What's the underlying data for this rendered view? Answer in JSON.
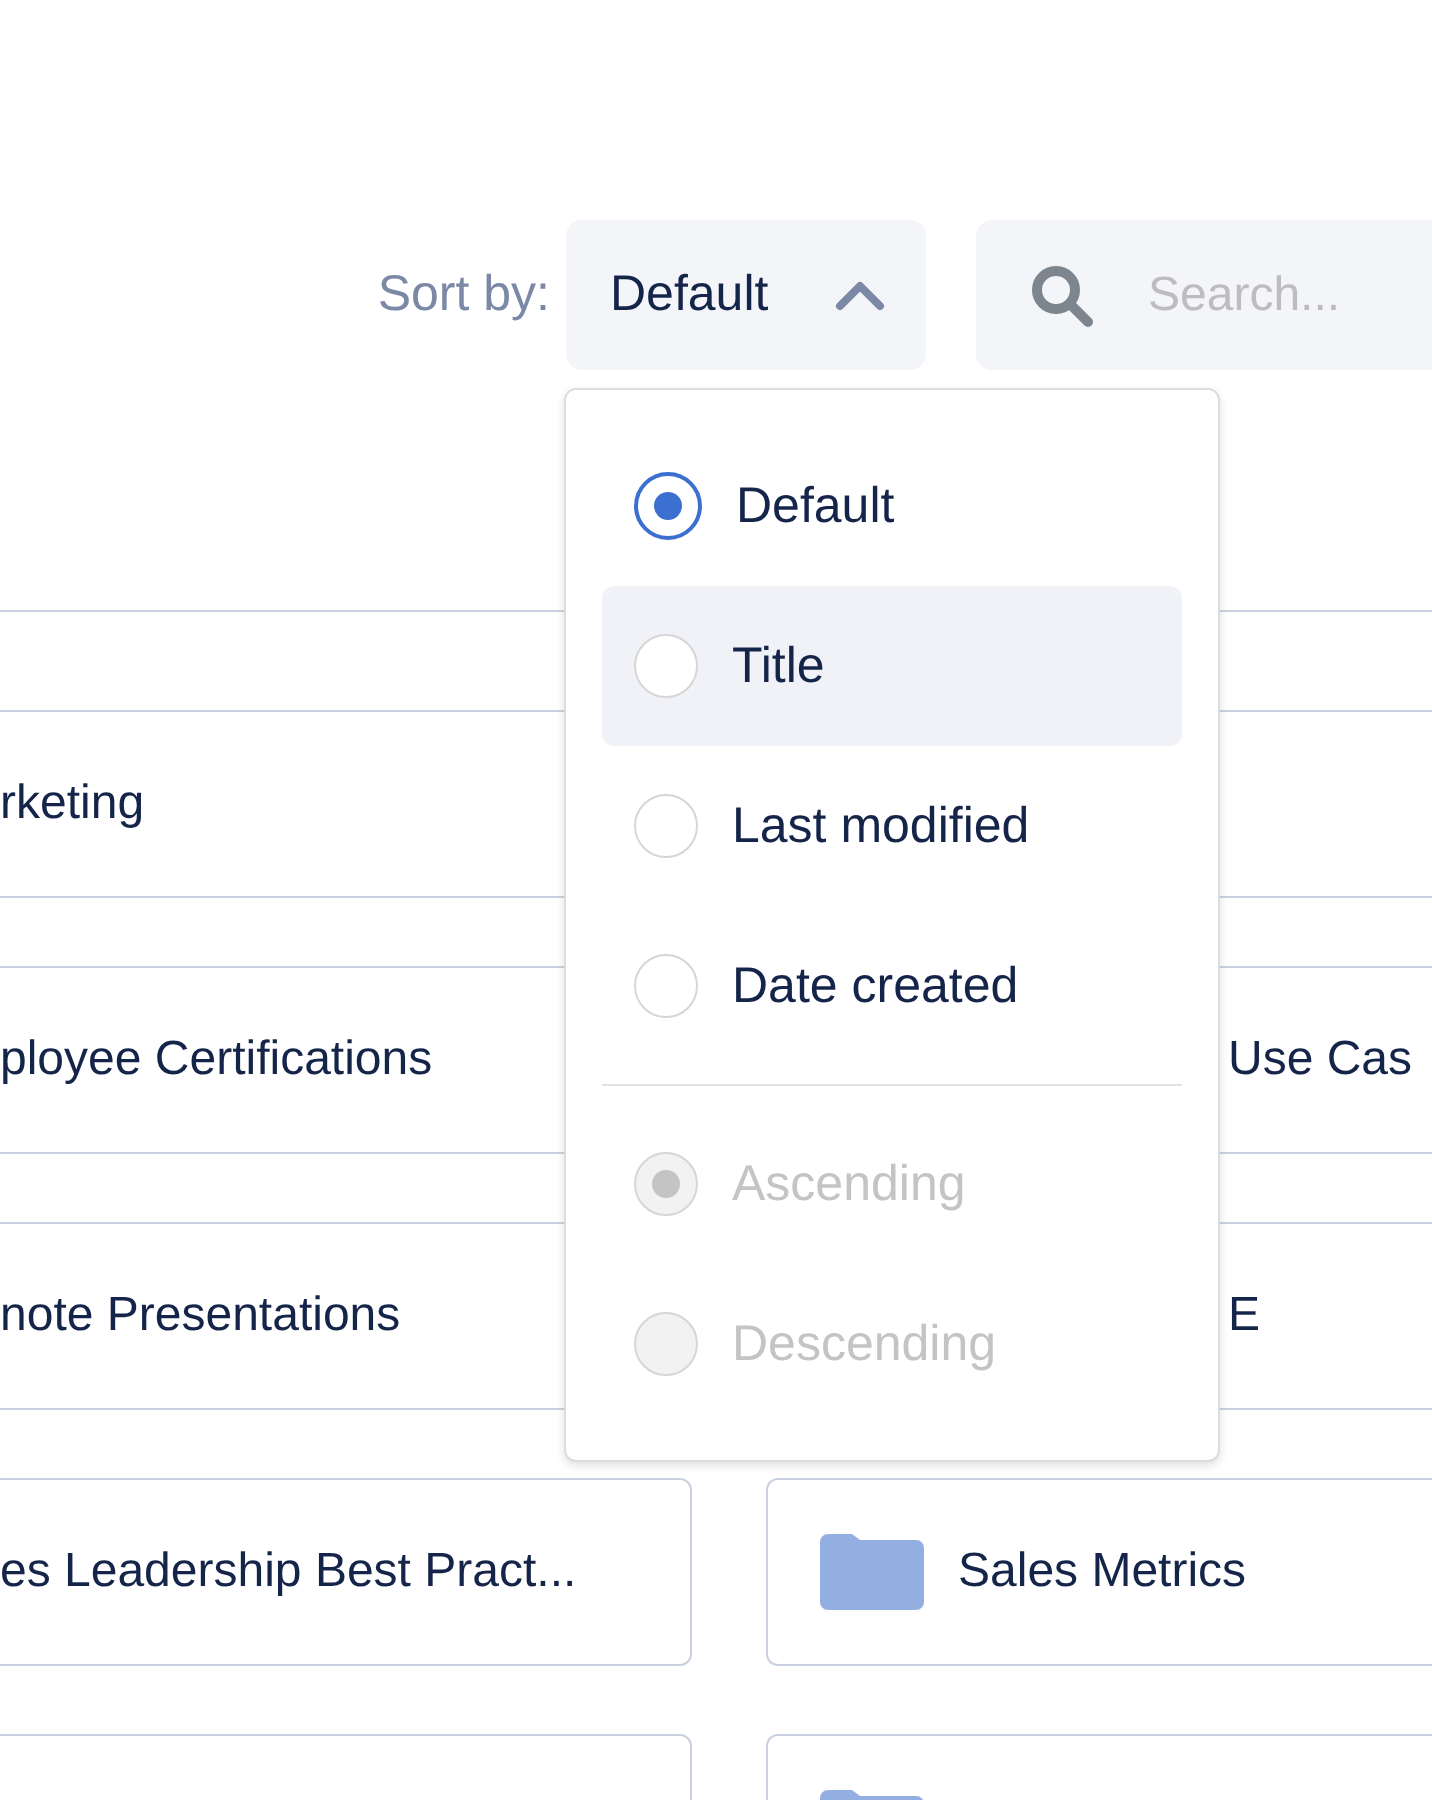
{
  "sort": {
    "label": "Sort by:",
    "value": "Default",
    "expanded": true
  },
  "search": {
    "placeholder": "Search..."
  },
  "sort_menu": {
    "fields": [
      {
        "label": "Default",
        "selected": true,
        "highlighted": false,
        "disabled": false
      },
      {
        "label": "Title",
        "selected": false,
        "highlighted": true,
        "disabled": false
      },
      {
        "label": "Last modified",
        "selected": false,
        "highlighted": false,
        "disabled": false
      },
      {
        "label": "Date created",
        "selected": false,
        "highlighted": false,
        "disabled": false
      }
    ],
    "orders": [
      {
        "label": "Ascending",
        "selected": true,
        "highlighted": false,
        "disabled": true
      },
      {
        "label": "Descending",
        "selected": false,
        "highlighted": false,
        "disabled": true
      }
    ]
  },
  "folder_rows": [
    {
      "left": {
        "title": "rketing"
      },
      "right": {
        "kind": "covered"
      }
    },
    {
      "left": {
        "title": "ployee Certifications"
      },
      "right": {
        "kind": "covered",
        "title": "Use Cas"
      }
    },
    {
      "left": {
        "title": "note Presentations"
      },
      "right": {
        "kind": "covered",
        "title": "E"
      }
    },
    {
      "left": {
        "title": "es Leadership Best Pract..."
      },
      "right": {
        "kind": "folder",
        "title": "Sales Metrics"
      }
    },
    {
      "left": {},
      "right": {
        "kind": "folder"
      }
    }
  ]
}
